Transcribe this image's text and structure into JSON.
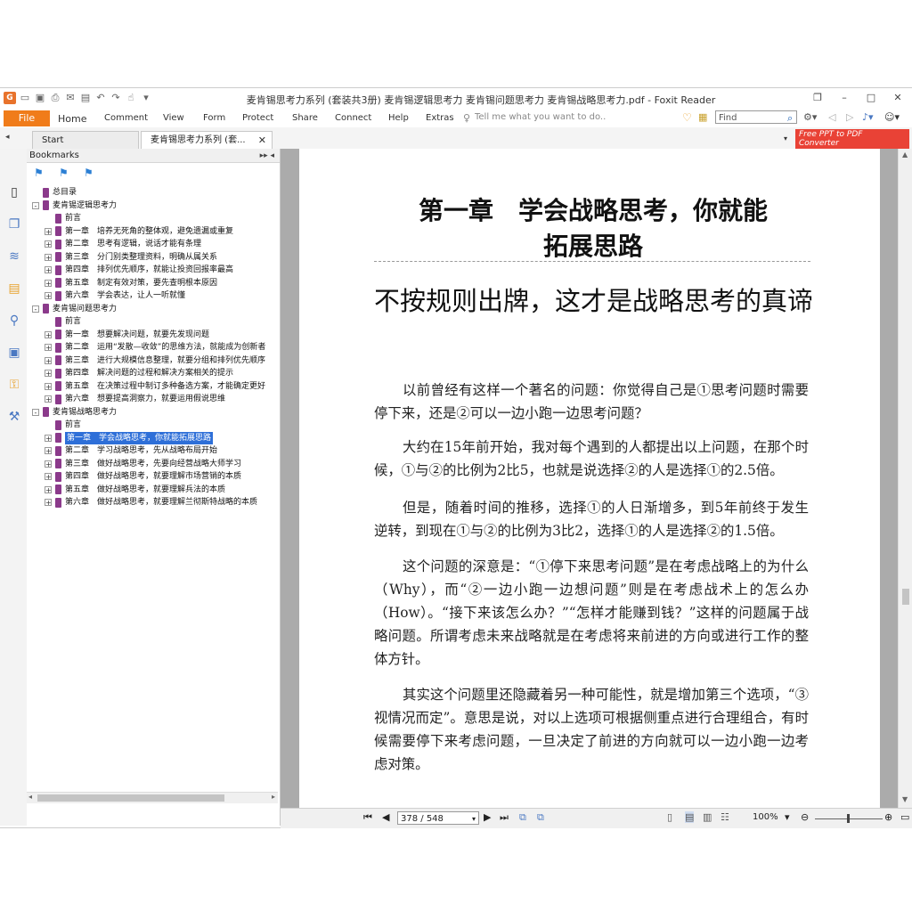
{
  "window": {
    "title": "麦肯锡思考力系列 (套装共3册) 麦肯锡逻辑思考力 麦肯锡问题思考力 麦肯锡战略思考力.pdf - Foxit Reader"
  },
  "ribbon": {
    "file": "File",
    "tabs": [
      "Home",
      "Comment",
      "View",
      "Form",
      "Protect",
      "Share",
      "Connect",
      "Help",
      "Extras"
    ],
    "tell_me": "Tell me what you want to do..",
    "find_placeholder": "Find"
  },
  "doc_tabs": {
    "start": "Start",
    "current": "麦肯锡思考力系列 (套...",
    "close": "✕"
  },
  "promo": {
    "line1": "Free PPT to PDF",
    "line2": "Converter"
  },
  "bookmarks": {
    "header": "Bookmarks",
    "items": [
      {
        "level": 0,
        "exp": "",
        "text": "总目录"
      },
      {
        "level": 0,
        "exp": "-",
        "text": "麦肯锡逻辑思考力"
      },
      {
        "level": 1,
        "exp": "",
        "text": "前言"
      },
      {
        "level": 1,
        "exp": "+",
        "text": "第一章　培养无死角的整体观，避免遗漏或重复"
      },
      {
        "level": 1,
        "exp": "+",
        "text": "第二章　思考有逻辑，说话才能有条理"
      },
      {
        "level": 1,
        "exp": "+",
        "text": "第三章　分门别类整理资料，明确从属关系"
      },
      {
        "level": 1,
        "exp": "+",
        "text": "第四章　排列优先顺序，就能让投资回报率最高"
      },
      {
        "level": 1,
        "exp": "+",
        "text": "第五章　制定有效对策，要先查明根本原因"
      },
      {
        "level": 1,
        "exp": "+",
        "text": "第六章　学会表达，让人一听就懂"
      },
      {
        "level": 0,
        "exp": "-",
        "text": "麦肯锡问题思考力"
      },
      {
        "level": 1,
        "exp": "",
        "text": "前言"
      },
      {
        "level": 1,
        "exp": "+",
        "text": "第一章　想要解决问题，就要先发现问题"
      },
      {
        "level": 1,
        "exp": "+",
        "text": "第二章　运用“发散—收敛”的思维方法，就能成为创新者"
      },
      {
        "level": 1,
        "exp": "+",
        "text": "第三章　进行大规模信息整理，就要分组和排列优先顺序"
      },
      {
        "level": 1,
        "exp": "+",
        "text": "第四章　解决问题的过程和解决方案相关的提示"
      },
      {
        "level": 1,
        "exp": "+",
        "text": "第五章　在决策过程中制订多种备选方案，才能确定更好"
      },
      {
        "level": 1,
        "exp": "+",
        "text": "第六章　想要提高洞察力，就要运用假说思维"
      },
      {
        "level": 0,
        "exp": "-",
        "text": "麦肯锡战略思考力"
      },
      {
        "level": 1,
        "exp": "",
        "text": "前言"
      },
      {
        "level": 1,
        "exp": "+",
        "text": "第一章　学会战略思考，你就能拓展思路",
        "selected": true
      },
      {
        "level": 1,
        "exp": "+",
        "text": "第二章　学习战略思考，先从战略布局开始"
      },
      {
        "level": 1,
        "exp": "+",
        "text": "第三章　做好战略思考，先要向经营战略大师学习"
      },
      {
        "level": 1,
        "exp": "+",
        "text": "第四章　做好战略思考，就要理解市场营销的本质"
      },
      {
        "level": 1,
        "exp": "+",
        "text": "第五章　做好战略思考，就要理解兵法的本质"
      },
      {
        "level": 1,
        "exp": "+",
        "text": "第六章　做好战略思考，就要理解兰彻斯特战略的本质"
      }
    ]
  },
  "document": {
    "chapter_title_line1": "第一章　学会战略思考，你就能",
    "chapter_title_line2": "拓展思路",
    "section_title": "不按规则出牌，这才是战略思考的真谛",
    "paragraphs": [
      "以前曾经有这样一个著名的问题：你觉得自己是①思考问题时需要停下来，还是②可以一边小跑一边思考问题？",
      "大约在15年前开始，我对每个遇到的人都提出以上问题，在那个时候，①与②的比例为2比5，也就是说选择②的人是选择①的2.5倍。",
      "但是，随着时间的推移，选择①的人日渐增多，到5年前终于发生逆转，到现在①与②的比例为3比2，选择①的人是选择②的1.5倍。",
      "这个问题的深意是：“①停下来思考问题”是在考虑战略上的为什么（Why），而“②一边小跑一边想问题”则是在考虑战术上的怎么办（How）。“接下来该怎么办？”“怎样才能赚到钱？”这样的问题属于战略问题。所谓考虑未来战略就是在考虑将来前进的方向或进行工作的整体方针。",
      "其实这个问题里还隐藏着另一种可能性，就是增加第三个选项，“③视情况而定”。意思是说，对以上选项可根据侧重点进行合理组合，有时候需要停下来考虑问题，一旦决定了前进的方向就可以一边小跑一边考虑对策。"
    ]
  },
  "statusbar": {
    "page_value": "378 / 548",
    "zoom_level": "100%"
  },
  "colors": {
    "file_tab": "#f07c1a",
    "selection": "#2e6fd8",
    "bookmark_flag": "#8b3a8b",
    "promo": "#e94236"
  }
}
